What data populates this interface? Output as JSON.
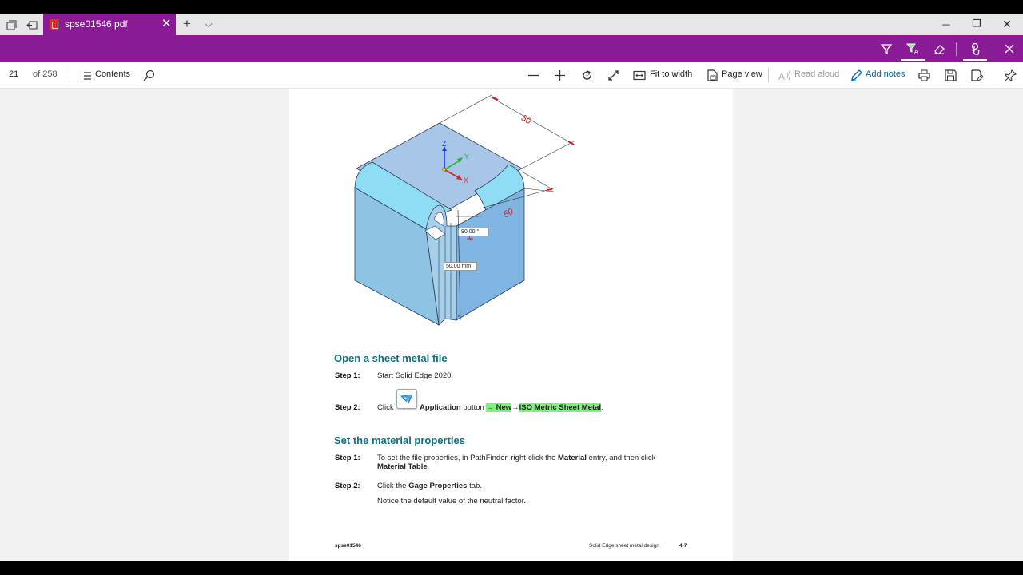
{
  "browser": {
    "tab_title": "spse01546.pdf",
    "tab_close": "✕",
    "new_tab": "+",
    "tab_list": "⌵",
    "win_min": "─",
    "win_restore": "❐",
    "win_close": "✕"
  },
  "pdf_toolbar": {
    "page_number": "21",
    "page_total": "of 258",
    "contents_label": "Contents",
    "fit_to_width_label": "Fit to width",
    "page_view_label": "Page view",
    "read_aloud_label": "Read aloud",
    "add_notes_label": "Add notes"
  },
  "figure": {
    "dim_top": "50",
    "dim_side": "50",
    "angle_label": "90.00 °",
    "length_label": "50.00 mm",
    "axis_z": "Z",
    "axis_y": "Y",
    "axis_x": "X"
  },
  "document": {
    "section1_title": "Open a sheet metal file",
    "s1_step1_label": "Step 1:",
    "s1_step1_text": "Start Solid Edge 2020.",
    "s1_step2_label": "Step 2:",
    "s1_step2_click": "Click",
    "s1_step2_app": "Application",
    "s1_step2_button": "button",
    "s1_step2_path1": "→ New",
    "s1_step2_arrow": "→",
    "s1_step2_path2": "ISO Metric Sheet Metal",
    "s1_step2_end": ".",
    "section2_title": "Set the material properties",
    "s2_step1_label": "Step 1:",
    "s2_step1_text_a": "To set the file properties, in PathFinder, right-click the",
    "s2_step1_material": "Material",
    "s2_step1_text_b": "entry, and then click",
    "s2_step1_table": "Material Table",
    "s2_step1_end": ".",
    "s2_step2_label": "Step 2:",
    "s2_step2_text_a": "Click the",
    "s2_step2_gage": "Gage Properties",
    "s2_step2_text_b": "tab.",
    "s2_step2_note": "Notice the default value of the neutral factor.",
    "footer_left": "spse01546",
    "footer_right": "Solid Edge sheet metal design",
    "footer_page": "4-7"
  },
  "colors": {
    "accent": "#8a1a96",
    "heading": "#0f6f84",
    "highlight": "#7ef07e"
  }
}
